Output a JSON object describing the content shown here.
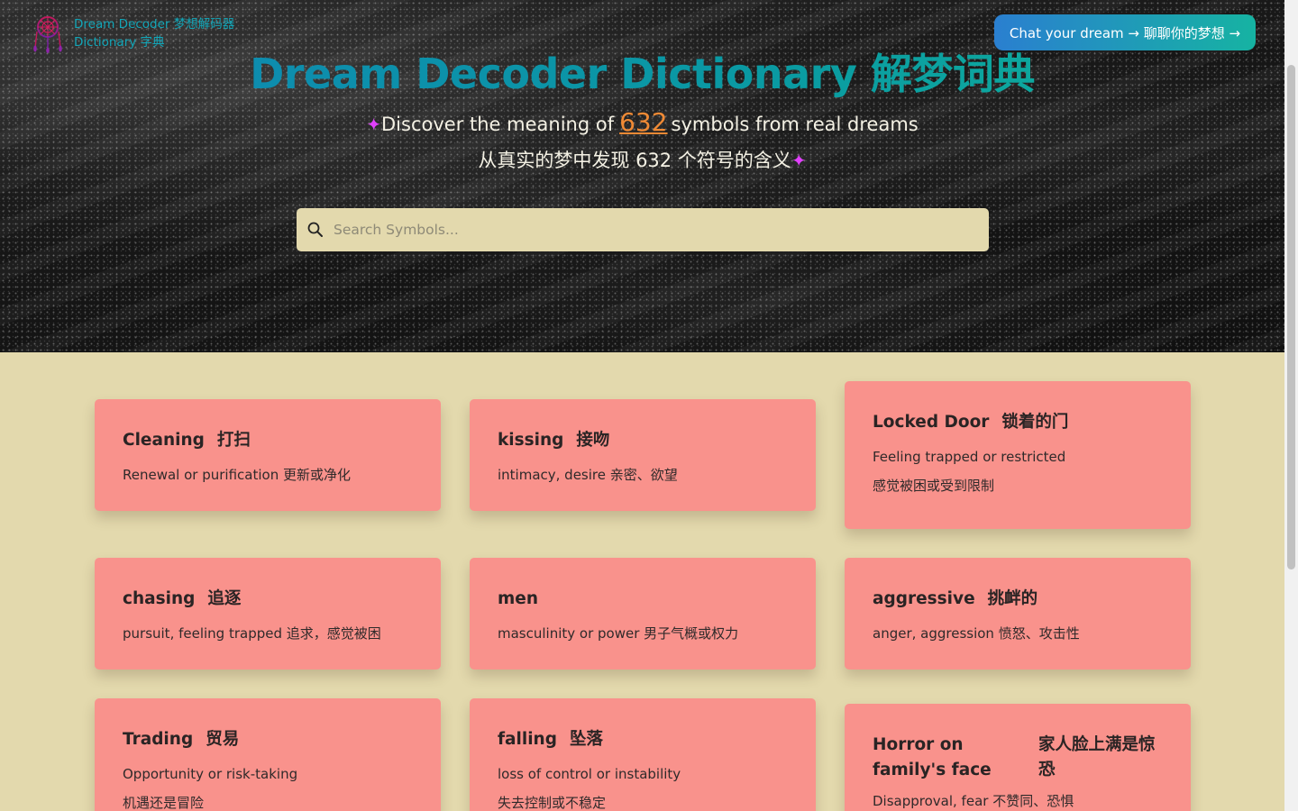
{
  "logo": {
    "line1": "Dream Decoder 梦想解码器",
    "line2": "Dictionary 字典"
  },
  "header": {
    "chat_button": "Chat your dream → 聊聊你的梦想 →",
    "title": "Dream Decoder Dictionary 解梦词典",
    "subtitle_prefix": "Discover the meaning of",
    "symbol_count": "632",
    "subtitle_suffix": "symbols from real dreams",
    "subtitle_cn": "从真实的梦中发现 632 个符号的含义"
  },
  "search": {
    "placeholder": "Search Symbols..."
  },
  "colors": {
    "accent_teal": "#0b90a6",
    "count_orange": "#f08a35",
    "card_bg": "#f9928c",
    "page_bg": "#e3d9ad",
    "sparkle": "#e040fb"
  },
  "cards": [
    {
      "en": "Cleaning",
      "cn": "打扫",
      "desc1": "Renewal or purification 更新或净化",
      "desc2": ""
    },
    {
      "en": "kissing",
      "cn": "接吻",
      "desc1": "intimacy, desire 亲密、欲望",
      "desc2": ""
    },
    {
      "en": "Locked Door",
      "cn": "锁着的门",
      "desc1": "Feeling trapped or restricted",
      "desc2": "感觉被困或受到限制"
    },
    {
      "en": "chasing",
      "cn": "追逐",
      "desc1": "pursuit, feeling trapped 追求，感觉被困",
      "desc2": ""
    },
    {
      "en": "men",
      "cn": "",
      "desc1": "masculinity or power 男子气概或权力",
      "desc2": ""
    },
    {
      "en": "aggressive",
      "cn": "挑衅的",
      "desc1": "anger, aggression 愤怒、攻击性",
      "desc2": ""
    },
    {
      "en": "Trading",
      "cn": "贸易",
      "desc1": "Opportunity or risk-taking",
      "desc2": "机遇还是冒险"
    },
    {
      "en": "falling",
      "cn": "坠落",
      "desc1": "loss of control or instability",
      "desc2": "失去控制或不稳定"
    },
    {
      "en": "Horror on family's face",
      "cn": "家人脸上满是惊恐",
      "desc1": "Disapproval, fear 不赞同、恐惧",
      "desc2": ""
    }
  ]
}
